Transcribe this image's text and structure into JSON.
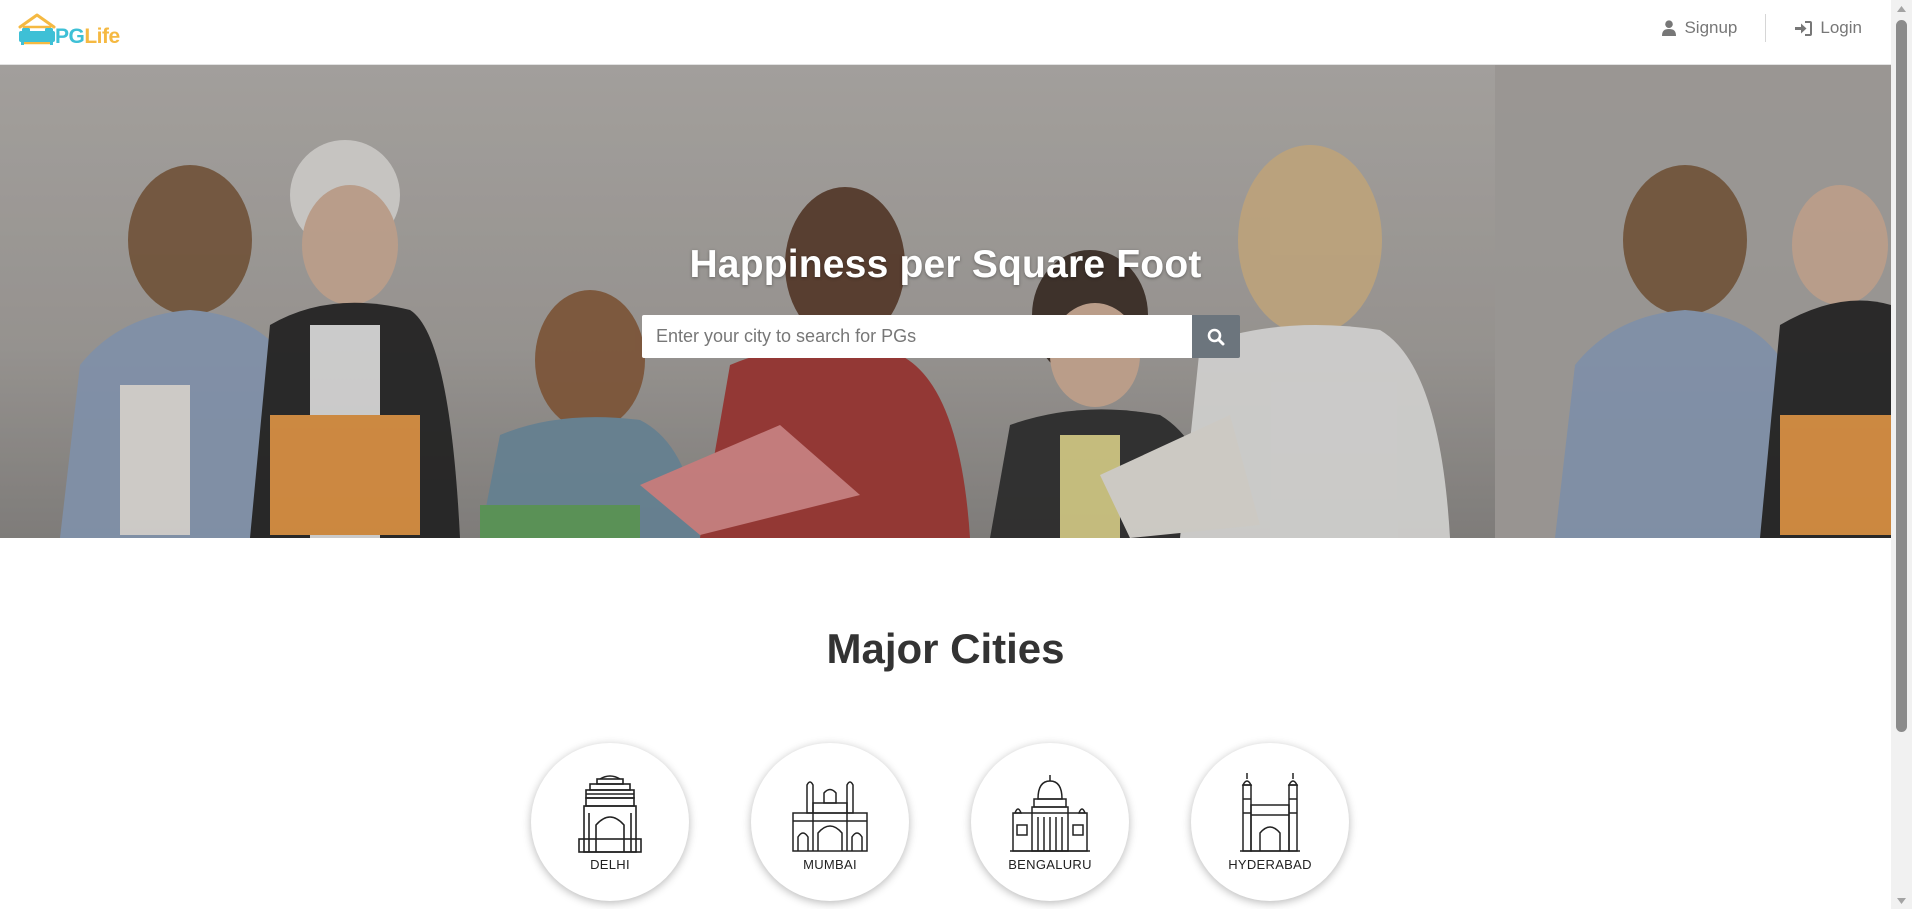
{
  "brand": {
    "name_part1": "PG",
    "name_part2": "Life",
    "color_primary": "#3ec0d6",
    "color_secondary": "#f5b942"
  },
  "nav": {
    "signup_label": "Signup",
    "signup_icon": "user-icon",
    "login_label": "Login",
    "login_icon": "sign-in-icon"
  },
  "hero": {
    "title": "Happiness per Square Foot",
    "search_placeholder": "Enter your city to search for PGs",
    "search_value": "",
    "search_icon": "search-icon",
    "search_button_color": "#6c757d"
  },
  "cities_section": {
    "title": "Major Cities",
    "cities": [
      {
        "name": "DELHI",
        "icon": "india-gate-icon"
      },
      {
        "name": "MUMBAI",
        "icon": "gateway-of-india-icon"
      },
      {
        "name": "BENGALURU",
        "icon": "vidhana-soudha-icon"
      },
      {
        "name": "HYDERABAD",
        "icon": "charminar-icon"
      }
    ]
  }
}
